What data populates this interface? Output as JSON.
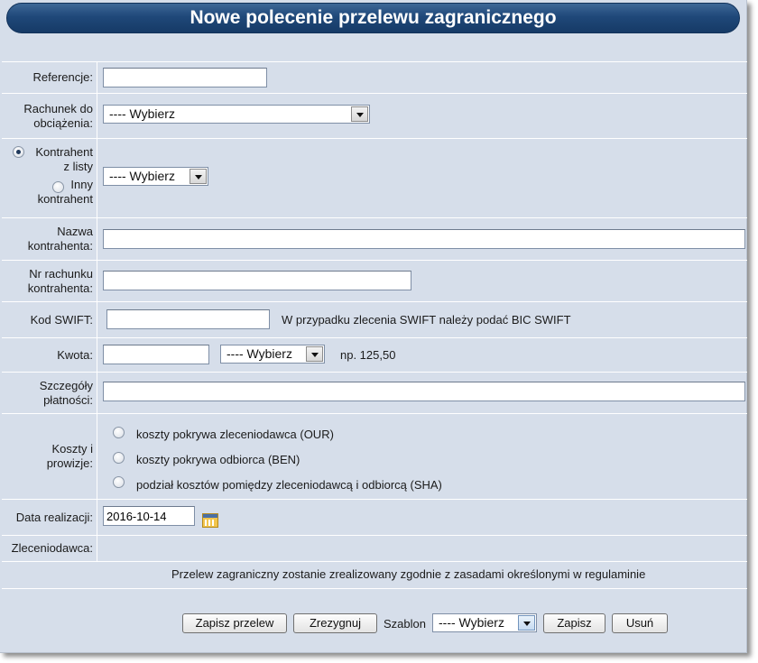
{
  "title": "Nowe polecenie przelewu zagranicznego",
  "form": {
    "referencje_label": "Referencje:",
    "referencje_value": "",
    "rachunek_label_1": "Rachunek do",
    "rachunek_label_2": "obciążenia:",
    "rachunek_select": "---- Wybierz",
    "kontrahent_z_listy_1": "Kontrahent",
    "kontrahent_z_listy_2": "z listy",
    "inny_kontrahent_1": "Inny",
    "inny_kontrahent_2": "kontrahent",
    "kontrahent_select": "---- Wybierz",
    "nazwa_label_1": "Nazwa",
    "nazwa_label_2": "kontrahenta:",
    "nazwa_value": "",
    "nr_label_1": "Nr rachunku",
    "nr_label_2": "kontrahenta:",
    "nr_value": "",
    "swift_label": "Kod SWIFT:",
    "swift_value": "",
    "swift_hint": "W przypadku zlecenia SWIFT należy podać BIC SWIFT",
    "kwota_label": "Kwota:",
    "kwota_value": "",
    "waluta_select": "---- Wybierz",
    "kwota_hint": "np. 125,50",
    "szczegoly_label_1": "Szczegóły",
    "szczegoly_label_2": "płatności:",
    "szczegoly_value": "",
    "koszty_label_1": "Koszty i",
    "koszty_label_2": "prowizje:",
    "koszty_options": [
      "koszty pokrywa zleceniodawca (OUR)",
      "koszty pokrywa odbiorca (BEN)",
      "podział kosztów pomiędzy zleceniodawcą i odbiorcą (SHA)"
    ],
    "data_label": "Data realizacji:",
    "data_value": "2016-10-14",
    "zleceniodawca_label": "Zleceniodawca:",
    "info_text": "Przelew zagraniczny zostanie zrealizowany zgodnie z zasadami określonymi w regulaminie"
  },
  "buttons": {
    "zapisz_przelew": "Zapisz przelew",
    "zrezygnuj": "Zrezygnuj",
    "szablon_label": "Szablon",
    "szablon_select": "---- Wybierz",
    "zapisz": "Zapisz",
    "usun": "Usuń"
  },
  "colors": {
    "background": "#d6deea",
    "title_bar": "#1f4879",
    "title_text": "#ffffff"
  },
  "icons": {
    "calendar": "calendar-icon"
  }
}
